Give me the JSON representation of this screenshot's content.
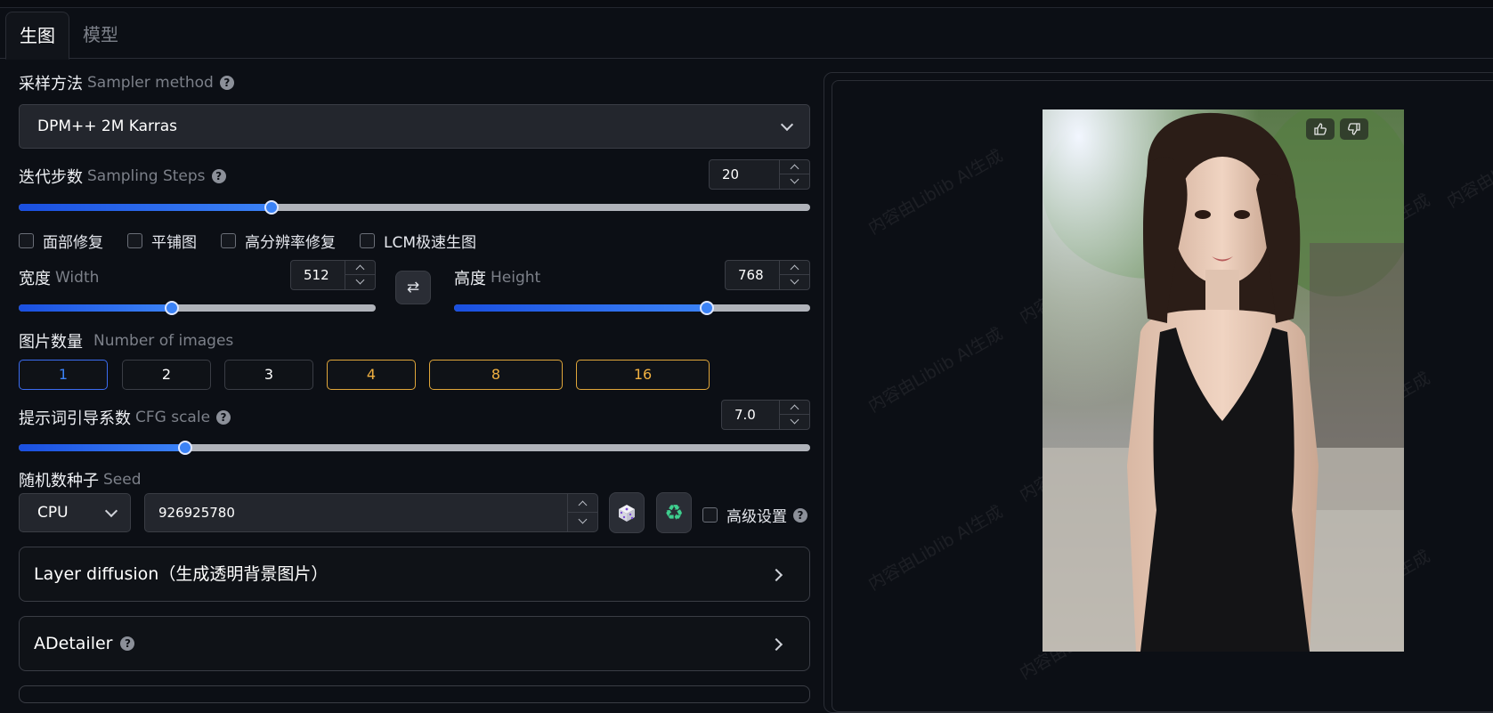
{
  "tabs": [
    {
      "label": "生图",
      "active": true
    },
    {
      "label": "模型",
      "active": false
    }
  ],
  "sampler": {
    "label_zh": "采样方法",
    "label_en": "Sampler method",
    "help": "?",
    "value": "DPM++ 2M Karras"
  },
  "steps": {
    "label_zh": "迭代步数",
    "label_en": "Sampling Steps",
    "help": "?",
    "value": "20",
    "fraction": 0.32
  },
  "toggles": [
    {
      "label": "面部修复",
      "checked": false
    },
    {
      "label": "平铺图",
      "checked": false
    },
    {
      "label": "高分辨率修复",
      "checked": false
    },
    {
      "label": "LCM极速生图",
      "checked": false
    }
  ],
  "width": {
    "label_zh": "宽度",
    "label_en": "Width",
    "value": "512",
    "fraction": 0.43
  },
  "swap_icon": "swap-arrows-icon",
  "height": {
    "label_zh": "高度",
    "label_en": "Height",
    "value": "768",
    "fraction": 0.71
  },
  "num_images": {
    "label_zh": "图片数量",
    "label_en": "Number of images",
    "options": [
      "1",
      "2",
      "3",
      "4",
      "8",
      "16"
    ],
    "selected": "1"
  },
  "cfg": {
    "label_zh": "提示词引导系数",
    "label_en": "CFG scale",
    "help": "?",
    "value": "7.0",
    "fraction": 0.21
  },
  "seed": {
    "label_zh": "随机数种子",
    "label_en": "Seed",
    "device": "CPU",
    "value": "926925780",
    "dice_icon": "dice-icon",
    "recycle_icon": "recycle-icon",
    "advanced_label": "高级设置",
    "help": "?"
  },
  "sections": [
    {
      "label": "Layer diffusion（生成透明背景图片）",
      "has_help": false
    },
    {
      "label": "ADetailer",
      "has_help": true,
      "help": "?"
    }
  ],
  "preview": {
    "watermark": "内容由Liblib AI生成",
    "feedback_icons": [
      "thumbs-up-icon",
      "thumbs-down-icon"
    ]
  },
  "colors": {
    "accent": "#3b82f6",
    "gold": "#f0b040",
    "bg": "#0c0f15"
  }
}
